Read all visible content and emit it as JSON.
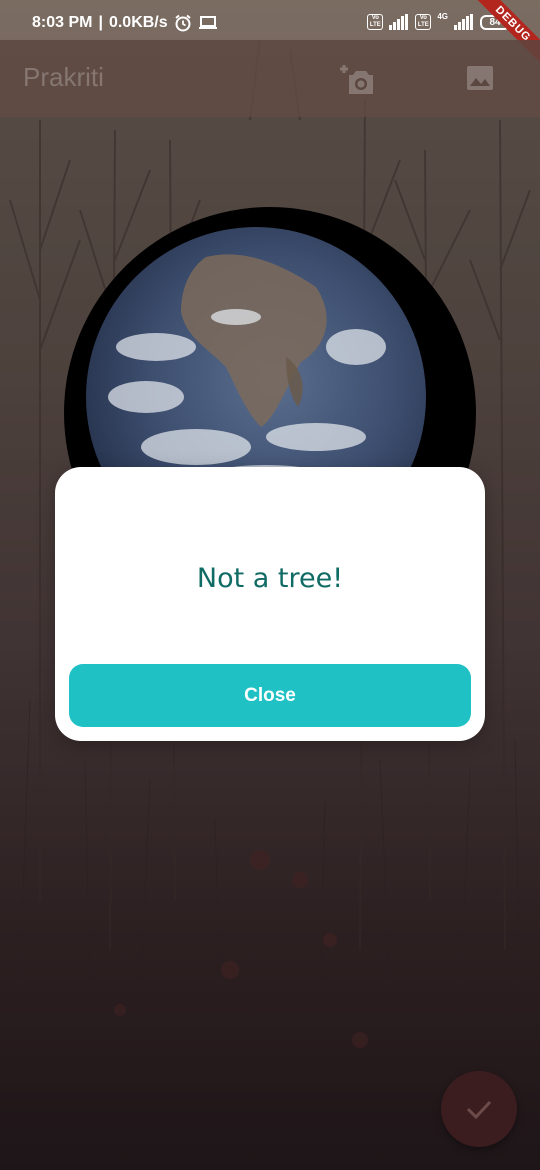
{
  "status_bar": {
    "time": "8:03 PM",
    "network_speed": "0.0KB/s",
    "separator": "|",
    "volte_1": "Vo LTE",
    "volte_2": "Vo LTE",
    "network_type": "4G",
    "battery": "84"
  },
  "debug_banner": "DEBUG",
  "app_bar": {
    "title": "Prakriti",
    "camera_icon": "add-a-photo-icon",
    "gallery_icon": "image-icon"
  },
  "dialog": {
    "message": "Not a tree!",
    "close_label": "Close"
  },
  "fab": {
    "icon": "check-icon"
  },
  "colors": {
    "accent": "#1fc1c4",
    "dialog_text": "#0f6b63",
    "debug_banner": "#b3261e"
  }
}
